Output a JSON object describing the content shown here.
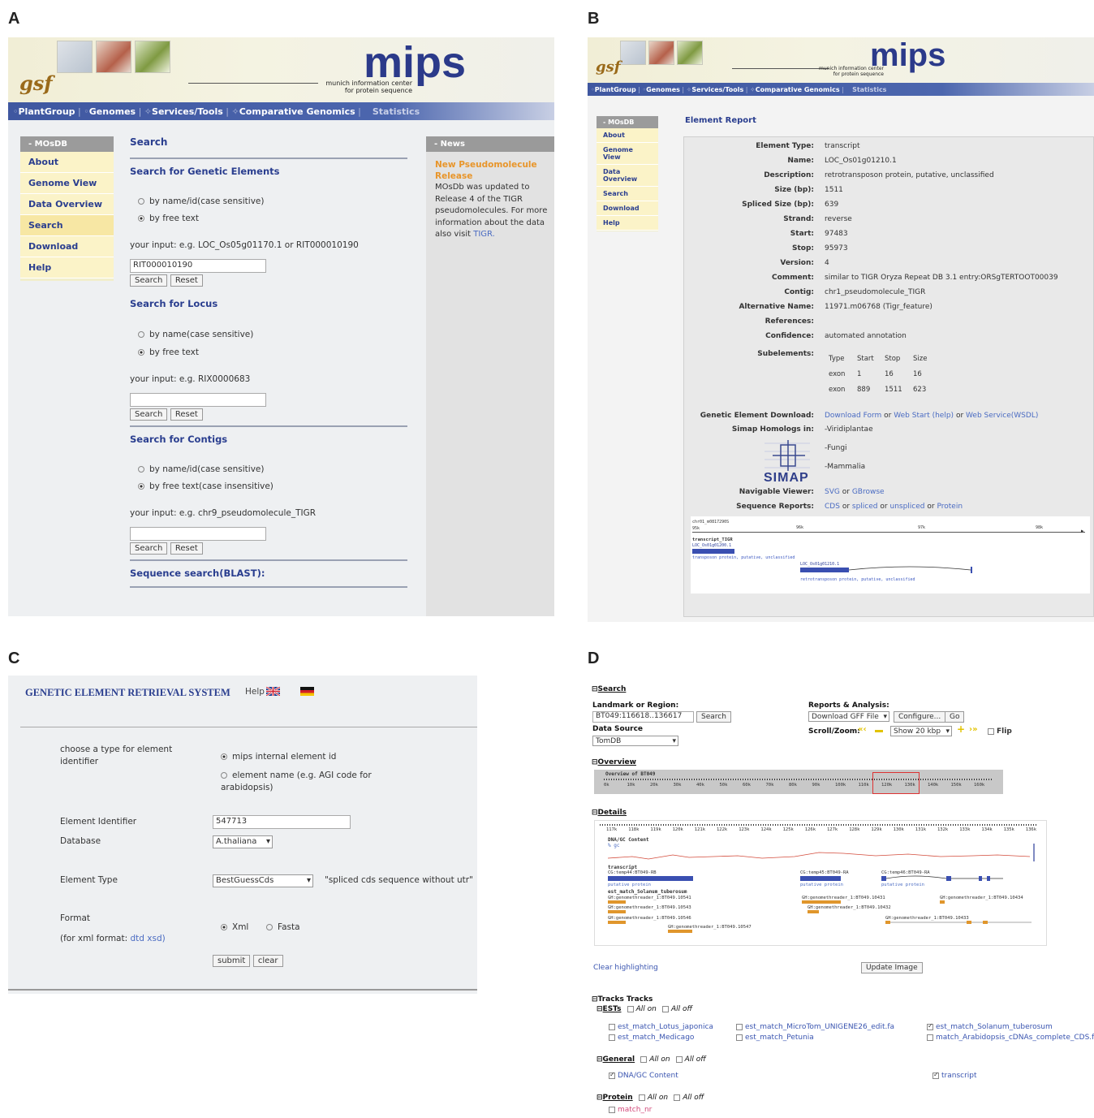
{
  "panels": {
    "a": "A",
    "b": "B",
    "c": "C",
    "d": "D"
  },
  "mips_header": {
    "logo_left": "gsf",
    "logo_right": "mips",
    "subtitle_1": "munich information center",
    "subtitle_2": "for protein sequence"
  },
  "nav": {
    "items": [
      "PlantGroup",
      "Genomes",
      "Services/Tools",
      "Comparative Genomics",
      "Statistics"
    ]
  },
  "panel_a": {
    "sidebar": {
      "title": "- MOsDB",
      "items": [
        "About",
        "Genome View",
        "Data Overview",
        "Search",
        "Download",
        "Help"
      ]
    },
    "page_title": "Search",
    "genetic": {
      "title": "Search for Genetic Elements",
      "opt1": "by name/id(case sensitive)",
      "opt2": "by free text",
      "hint": "your input: e.g. LOC_Os05g01170.1 or RIT000010190",
      "value": "RIT000010190",
      "search": "Search",
      "reset": "Reset"
    },
    "locus": {
      "title": "Search for Locus",
      "opt1": "by name(case sensitive)",
      "opt2": "by free text",
      "hint": "your input: e.g. RIX0000683",
      "search": "Search",
      "reset": "Reset"
    },
    "contigs": {
      "title": "Search for Contigs",
      "opt1": "by name/id(case sensitive)",
      "opt2": "by free text(case insensitive)",
      "hint": "your input: e.g. chr9_pseudomolecule_TIGR",
      "search": "Search",
      "reset": "Reset"
    },
    "blast": {
      "title": "Sequence search(BLAST):"
    },
    "news": {
      "title": "- News",
      "headline": "New Pseudomolecule Release",
      "body": "MOsDb was updated to Release 4 of the TIGR pseudomolecules. For more information about the data also visit",
      "link": "TIGR."
    }
  },
  "panel_b": {
    "sidebar": {
      "title": "- MOsDB",
      "items": [
        "About",
        "Genome View",
        "Data Overview",
        "Search",
        "Download",
        "Help"
      ]
    },
    "page_title": "Element Report",
    "fields": [
      {
        "k": "Element Type:",
        "v": "transcript"
      },
      {
        "k": "Name:",
        "v": "LOC_Os01g01210.1"
      },
      {
        "k": "Description:",
        "v": "retrotransposon protein, putative, unclassified"
      },
      {
        "k": "Size (bp):",
        "v": "1511"
      },
      {
        "k": "Spliced Size (bp):",
        "v": "639"
      },
      {
        "k": "Strand:",
        "v": "reverse"
      },
      {
        "k": "Start:",
        "v": "97483"
      },
      {
        "k": "Stop:",
        "v": "95973"
      },
      {
        "k": "Version:",
        "v": "4"
      },
      {
        "k": "Comment:",
        "v": "similar to TIGR Oryza Repeat DB 3.1 entry:ORSgTERTOOT00039"
      },
      {
        "k": "Contig:",
        "v": "chr1_pseudomolecule_TIGR"
      },
      {
        "k": "Alternative Name:",
        "v": "11971.m06768 (Tigr_feature)"
      },
      {
        "k": "References:",
        "v": ""
      },
      {
        "k": "Confidence:",
        "v": "automated annotation"
      }
    ],
    "subelements": {
      "label": "Subelements:",
      "headers": [
        "Type",
        "Start",
        "Stop",
        "Size"
      ],
      "rows": [
        [
          "exon",
          "1",
          "16",
          "16"
        ],
        [
          "exon",
          "889",
          "1511",
          "623"
        ]
      ]
    },
    "download": {
      "label": "Genetic Element Download:",
      "a": "Download Form",
      "or1": "or",
      "b": "Web Start (help)",
      "or2": "or",
      "c": "Web Service(WSDL)"
    },
    "simap": {
      "label": "Simap Homologs in:",
      "logo": "SIMAP",
      "links": [
        "-Viridiplantae",
        "-Fungi",
        "-Mammalia"
      ]
    },
    "viewer": {
      "label": "Navigable Viewer:",
      "a": "SVG",
      "or": "or",
      "b": "GBrowse"
    },
    "seqrep": {
      "label": "Sequence Reports:",
      "a": "CDS",
      "or1": "or",
      "b": "spliced",
      "or2": "or",
      "c": "unspliced",
      "or3": "or",
      "d": "Protein"
    },
    "track": {
      "contig": "chr01_m0817290S",
      "scale_start": "95k",
      "ticks": [
        "96k",
        "97k",
        "98k"
      ],
      "label": "transcript_TIGR",
      "name1": "LOC_Os01g01200.1",
      "desc1": "transposon protein, putative, unclassified",
      "name2": "LOC_Os01g01210.1",
      "desc2": "retrotransposon protein, putative, unclassified"
    }
  },
  "panel_c": {
    "title": "GENETIC ELEMENT RETRIEVAL SYSTEM",
    "help": "Help",
    "choose_label": "choose a type for element identifier",
    "id_opt1": "mips internal element id",
    "id_opt2": "element name (e.g. AGI code for arabidopsis)",
    "identifier_label": "Element Identifier",
    "identifier_value": "547713",
    "database_label": "Database",
    "database_value": "A.thaliana",
    "type_label": "Element Type",
    "type_value": "BestGuessCds",
    "type_desc": "\"spliced cds sequence without utr\"",
    "format_label": "Format",
    "format_note": "(for xml format:",
    "format_dtd": "dtd",
    "format_xsd": "xsd)",
    "format_opt1": "Xml",
    "format_opt2": "Fasta",
    "submit": "submit",
    "clear": "clear"
  },
  "panel_d": {
    "search_title": "Search",
    "landmark_label": "Landmark or Region:",
    "landmark_value": "BT049:116618..136617",
    "search_btn": "Search",
    "source_label": "Data Source",
    "source_value": "TomDB",
    "reports_label": "Reports & Analysis:",
    "reports_value": "Download GFF File",
    "configure": "Configure...",
    "go": "Go",
    "scroll_label": "Scroll/Zoom:",
    "zoom_value": "Show 20 kbp",
    "flip": "Flip",
    "overview_title": "Overview",
    "overview_label": "Overview of BT049",
    "overview_ticks": [
      "0k",
      "10k",
      "20k",
      "30k",
      "40k",
      "50k",
      "60k",
      "70k",
      "80k",
      "90k",
      "100k",
      "110k",
      "120k",
      "130k",
      "140k",
      "150k",
      "160k"
    ],
    "details_title": "Details",
    "details_ticks": [
      "117k",
      "118k",
      "119k",
      "120k",
      "121k",
      "122k",
      "123k",
      "124k",
      "125k",
      "126k",
      "127k",
      "128k",
      "129k",
      "130k",
      "131k",
      "132k",
      "133k",
      "134k",
      "135k",
      "136k"
    ],
    "gc_label": "DNA/GC Content",
    "gc_sub": "% gc",
    "transcript_label": "transcript",
    "tx1": "CG:temp44:BT049-RB",
    "tx2": "CG:temp45:BT049-RA",
    "tx3": "CG:temp46:BT049-RA",
    "putative": "putative protein",
    "est_label": "est_match_Solanum_tuberosum",
    "gth": [
      "GH:genomethreader_1:BT049.10541",
      "GH:genomethreader_1:BT049.10543",
      "GH:genomethreader_1:BT049.10546",
      "GH:genomethreader_1:BT049.10547",
      "GH:genomethreader_1:BT049.10431",
      "GH:genomethreader_1:BT049.10432",
      "GH:genomethreader_1:BT049.10433",
      "GH:genomethreader_1:BT049.10434"
    ],
    "clear_highlight": "Clear highlighting",
    "update_image": "Update Image",
    "tracks_title": "Tracks Tracks",
    "ests_title": "ESTs",
    "all_on": "All on",
    "all_off": "All off",
    "est_tracks": [
      "est_match_Lotus_japonica",
      "est_match_Medicago",
      "est_match_MicroTom_UNIGENE26_edit.fa",
      "est_match_Petunia",
      "est_match_Solanum_tuberosum",
      "match_Arabidopsis_cDNAs_complete_CDS.fa"
    ],
    "general_title": "General",
    "general_tracks": [
      "DNA/GC Content",
      "transcript"
    ],
    "protein_title": "Protein",
    "protein_tracks": [
      "match_nr"
    ]
  }
}
